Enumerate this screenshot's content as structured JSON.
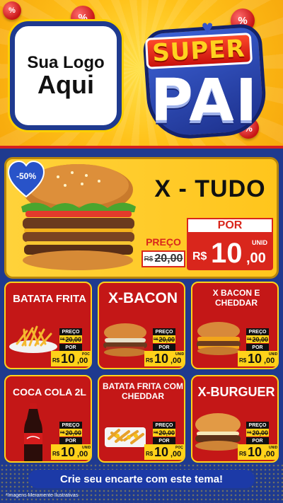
{
  "logo": {
    "line1": "Sua Logo",
    "line2": "Aqui"
  },
  "brand": {
    "word1": "SUPER",
    "word2": "PAI"
  },
  "percent_symbol": "%",
  "featured": {
    "discount": "-50%",
    "title": "X - TUDO",
    "preco_label": "PREÇO",
    "old_currency": "R$",
    "old_price": "20,00",
    "por_label": "POR",
    "currency": "R$",
    "price_int": "10",
    "price_dec": ",00",
    "unit": "UNID"
  },
  "price_labels": {
    "preco": "PREÇO",
    "por": "POR",
    "currency": "R$",
    "old_currency": "R$",
    "old_price": "20,00",
    "price_int": "10",
    "price_dec": ",00"
  },
  "cards": [
    {
      "title": "BATATA FRITA",
      "unit": "POC"
    },
    {
      "title": "X-BACON",
      "unit": "UNID"
    },
    {
      "title": "X BACON E CHEDDAR",
      "unit": "UNID"
    },
    {
      "title": "COCA COLA 2L",
      "unit": "UNID"
    },
    {
      "title": "BATATA FRITA COM CHEDDAR",
      "unit": "POÇ"
    },
    {
      "title": "X-BURGUER",
      "unit": "UNID"
    }
  ],
  "footer": {
    "cta": "Crie seu encarte com este tema!",
    "disclaimer": "*Imagens Meramente Ilustrativas"
  },
  "colors": {
    "yellow": "#ffc51c",
    "red": "#c41717",
    "blue": "#1f3a8f"
  }
}
